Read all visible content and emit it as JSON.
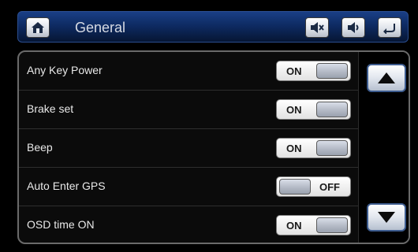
{
  "header": {
    "title": "General",
    "icons": [
      "home-icon",
      "mute-icon",
      "speaker-icon",
      "back-icon"
    ]
  },
  "settings": [
    {
      "label": "Any Key Power",
      "state": "ON"
    },
    {
      "label": "Brake set",
      "state": "ON"
    },
    {
      "label": "Beep",
      "state": "ON"
    },
    {
      "label": "Auto Enter GPS",
      "state": "OFF"
    },
    {
      "label": "OSD time ON",
      "state": "ON"
    }
  ],
  "scroll": {
    "up_icon": "triangle-up-icon",
    "down_icon": "triangle-down-icon"
  },
  "colors": {
    "header_blue": "#0e2b63",
    "panel_border": "#6a6a6a",
    "accent_blue": "#3d5c8f"
  }
}
